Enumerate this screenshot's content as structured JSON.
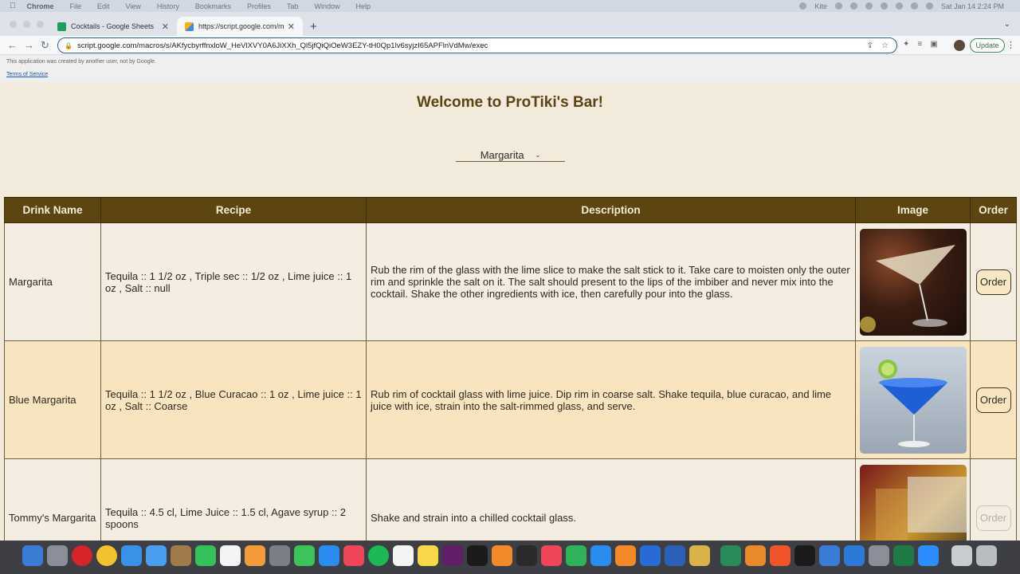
{
  "menubar": {
    "apple": "",
    "items": [
      "Chrome",
      "File",
      "Edit",
      "View",
      "History",
      "Bookmarks",
      "Profiles",
      "Tab",
      "Window",
      "Help"
    ],
    "status": {
      "kite": "Kite",
      "datetime": "Sat Jan 14  2:24 PM"
    }
  },
  "tabs": [
    {
      "title": "Cocktails - Google Sheets"
    },
    {
      "title": "https://script.google.com/mac"
    }
  ],
  "toolbar": {
    "url": "script.google.com/macros/s/AKfycbyrffnxloW_HeVlXVY0A6JiXXh_Ql5jfQiQiOeW3EZY-tH0Qp1lv6syjzI65APFlnVdMw/exec",
    "update_label": "Update"
  },
  "banner": {
    "note": "This application was created by another user, not by Google.",
    "terms": "Terms of Service"
  },
  "page": {
    "title": "Welcome to ProTiki's Bar!",
    "selected_drink": "Margarita"
  },
  "table": {
    "headers": [
      "Drink Name",
      "Recipe",
      "Description",
      "Image",
      "Order"
    ],
    "rows": [
      {
        "name": "Margarita",
        "recipe": "Tequila :: 1 1/2 oz , Triple sec :: 1/2 oz , Lime juice :: 1 oz , Salt :: null",
        "description": "Rub the rim of the glass with the lime slice to make the salt stick to it. Take care to moisten only the outer rim and sprinkle the salt on it. The salt should present to the lips of the imbiber and never mix into the cocktail. Shake the other ingredients with ice, then carefully pour into the glass.",
        "order": "Order"
      },
      {
        "name": "Blue Margarita",
        "recipe": "Tequila :: 1 1/2 oz , Blue Curacao :: 1 oz , Lime juice :: 1 oz , Salt :: Coarse",
        "description": "Rub rim of cocktail glass with lime juice. Dip rim in coarse salt. Shake tequila, blue curacao, and lime juice with ice, strain into the salt-rimmed glass, and serve.",
        "order": "Order"
      },
      {
        "name": "Tommy's Margarita",
        "recipe": "Tequila :: 4.5 cl, Lime Juice :: 1.5 cl, Agave syrup :: 2 spoons",
        "description": "Shake and strain into a chilled cocktail glass.",
        "order": "Order"
      }
    ]
  }
}
